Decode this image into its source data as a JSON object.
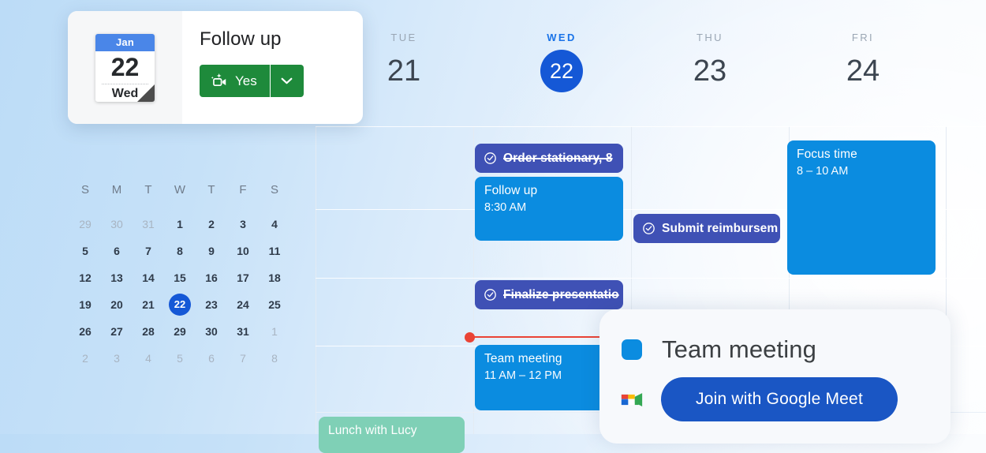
{
  "app": "Google Calendar week view",
  "notification": {
    "date_chip": {
      "month": "Jan",
      "day": "22",
      "weekday": "Wed"
    },
    "title": "Follow up",
    "yes_label": "Yes",
    "yes_icon": "sparkle-video-camera-icon",
    "caret_icon": "chevron-down-icon",
    "accent_green": "#1e8a3b"
  },
  "mini_calendar": {
    "weekday_headers": [
      "S",
      "M",
      "T",
      "W",
      "T",
      "F",
      "S"
    ],
    "selected_day": "22",
    "weeks": [
      [
        {
          "d": "29",
          "muted": true
        },
        {
          "d": "30",
          "muted": true
        },
        {
          "d": "31",
          "muted": true
        },
        {
          "d": "1",
          "muted": false
        },
        {
          "d": "2",
          "muted": false
        },
        {
          "d": "3",
          "muted": false
        },
        {
          "d": "4",
          "muted": false
        }
      ],
      [
        {
          "d": "5",
          "muted": false
        },
        {
          "d": "6",
          "muted": false
        },
        {
          "d": "7",
          "muted": false
        },
        {
          "d": "8",
          "muted": false
        },
        {
          "d": "9",
          "muted": false
        },
        {
          "d": "10",
          "muted": false
        },
        {
          "d": "11",
          "muted": false
        }
      ],
      [
        {
          "d": "12",
          "muted": false
        },
        {
          "d": "13",
          "muted": false
        },
        {
          "d": "14",
          "muted": false
        },
        {
          "d": "15",
          "muted": false
        },
        {
          "d": "16",
          "muted": false
        },
        {
          "d": "17",
          "muted": false
        },
        {
          "d": "18",
          "muted": false
        }
      ],
      [
        {
          "d": "19",
          "muted": false
        },
        {
          "d": "20",
          "muted": false
        },
        {
          "d": "21",
          "muted": false
        },
        {
          "d": "22",
          "muted": false,
          "selected": true
        },
        {
          "d": "23",
          "muted": false
        },
        {
          "d": "24",
          "muted": false
        },
        {
          "d": "25",
          "muted": false
        }
      ],
      [
        {
          "d": "26",
          "muted": false
        },
        {
          "d": "27",
          "muted": false
        },
        {
          "d": "28",
          "muted": false
        },
        {
          "d": "29",
          "muted": false
        },
        {
          "d": "30",
          "muted": false
        },
        {
          "d": "31",
          "muted": false
        },
        {
          "d": "1",
          "muted": true
        }
      ],
      [
        {
          "d": "2",
          "muted": true
        },
        {
          "d": "3",
          "muted": true
        },
        {
          "d": "4",
          "muted": true
        },
        {
          "d": "5",
          "muted": true
        },
        {
          "d": "6",
          "muted": true
        },
        {
          "d": "7",
          "muted": true
        },
        {
          "d": "8",
          "muted": true
        }
      ]
    ]
  },
  "week_header": {
    "days": [
      {
        "dow": "TUE",
        "num": "21",
        "today": false
      },
      {
        "dow": "WED",
        "num": "22",
        "today": true
      },
      {
        "dow": "THU",
        "num": "23",
        "today": false
      },
      {
        "dow": "FRI",
        "num": "24",
        "today": false
      }
    ],
    "today_color": "#1a73e8",
    "today_pill_color": "#1558d6"
  },
  "events": {
    "order_stationary": {
      "title": "Order stationary, 8",
      "kind": "task",
      "completed": true,
      "color": "#3f51b5",
      "icon": "task-check-circle-icon"
    },
    "follow_up": {
      "title": "Follow up",
      "time": "8:30 AM",
      "kind": "event",
      "color": "#0b8ce0"
    },
    "submit_reimbursement": {
      "title": "Submit reimbursem",
      "kind": "task",
      "completed": false,
      "color": "#3f51b5",
      "icon": "task-check-circle-icon"
    },
    "focus_time": {
      "title": "Focus time",
      "time": "8 – 10 AM",
      "kind": "event",
      "color": "#0b8ce0"
    },
    "finalize_presentation": {
      "title": "Finalize presentatio",
      "kind": "task",
      "completed": true,
      "color": "#3f51b5",
      "icon": "task-check-circle-icon"
    },
    "team_meeting": {
      "title": "Team meeting",
      "time": "11 AM – 12 PM",
      "kind": "event",
      "color": "#0b8ce0"
    },
    "lunch_with_lucy": {
      "title": "Lunch with Lucy",
      "kind": "event",
      "color": "#7fd0b6"
    }
  },
  "now_indicator": {
    "color": "#ea4335"
  },
  "popup": {
    "title": "Team meeting",
    "color_chip": "#0b8ce0",
    "join_label": "Join with Google Meet",
    "join_color": "#1a56c4",
    "meet_icon": "google-meet-icon"
  }
}
